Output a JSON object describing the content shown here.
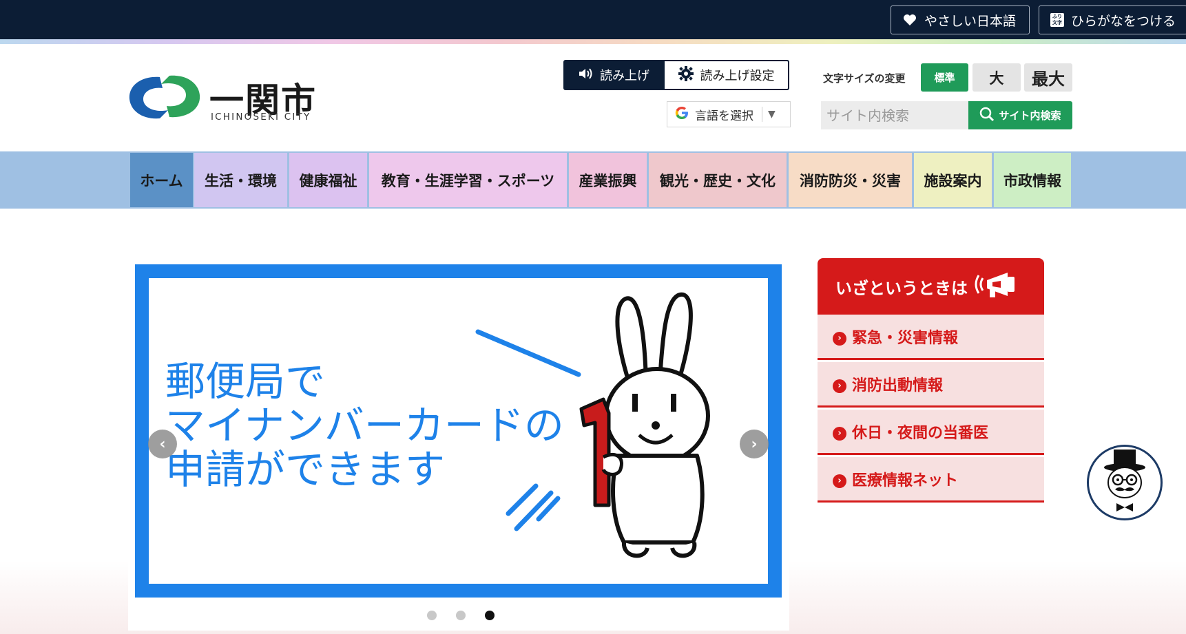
{
  "topbar": {
    "easy_japanese": "やさしい日本語",
    "furigana": "ひらがなをつける",
    "furigana_icon_text": "ふり文字"
  },
  "header": {
    "logo_name": "一関市",
    "logo_en": "ICHINOSEKI CITY",
    "read_aloud": "読み上げ",
    "read_aloud_settings": "読み上げ設定",
    "language_select": "言語を選択",
    "font_size_label": "文字サイズの変更",
    "font_sizes": [
      "標準",
      "大",
      "最大"
    ],
    "search_placeholder": "サイト内検索",
    "search_button": "サイト内検索"
  },
  "nav": {
    "items": [
      {
        "label": "ホーム",
        "color": "#5b91c6"
      },
      {
        "label": "生活・環境",
        "color": "#d1c6f1"
      },
      {
        "label": "健康福祉",
        "color": "#dcc2f0"
      },
      {
        "label": "教育・生涯学習・スポーツ",
        "color": "#eec8ec"
      },
      {
        "label": "産業振興",
        "color": "#f1c3dc"
      },
      {
        "label": "観光・歴史・文化",
        "color": "#efc8cc"
      },
      {
        "label": "消防防災・災害",
        "color": "#f7dcc6"
      },
      {
        "label": "施設案内",
        "color": "#eef0c1"
      },
      {
        "label": "市政情報",
        "color": "#cdeec4"
      }
    ]
  },
  "slider": {
    "lines": [
      "郵便局で",
      "マイナンバーカードの",
      "申請ができます"
    ],
    "prev": "‹",
    "next": "›",
    "dots": 3,
    "active_dot": 3
  },
  "emergency": {
    "title": "いざというときは",
    "items": [
      "緊急・災害情報",
      "消防出動情報",
      "休日・夜間の当番医",
      "医療情報ネット"
    ]
  },
  "colors": {
    "navy": "#0c1d35",
    "green": "#1f9b59",
    "red": "#d51a1a",
    "blue": "#1e82e9"
  }
}
